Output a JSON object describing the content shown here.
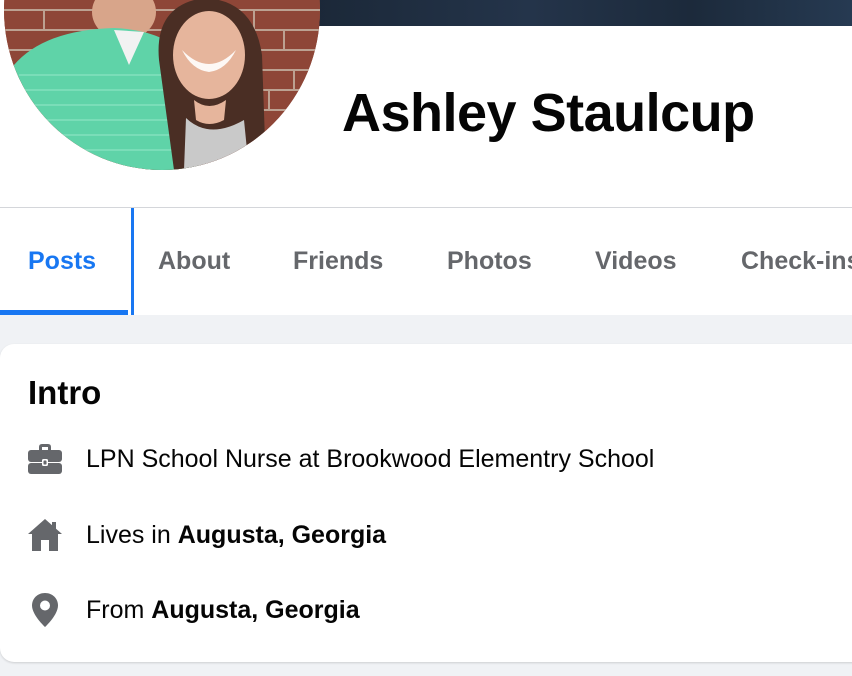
{
  "profile": {
    "name": "Ashley Staulcup"
  },
  "tabs": [
    {
      "label": "Posts",
      "active": true
    },
    {
      "label": "About",
      "active": false
    },
    {
      "label": "Friends",
      "active": false
    },
    {
      "label": "Photos",
      "active": false
    },
    {
      "label": "Videos",
      "active": false
    },
    {
      "label": "Check-ins",
      "active": false
    }
  ],
  "intro": {
    "title": "Intro",
    "work": {
      "icon": "briefcase-icon",
      "text": "LPN School Nurse at Brookwood Elementry School"
    },
    "lives": {
      "icon": "home-icon",
      "prefix": "Lives in ",
      "place": "Augusta, Georgia"
    },
    "from": {
      "icon": "location-pin-icon",
      "prefix": "From ",
      "place": "Augusta, Georgia"
    }
  },
  "colors": {
    "accent": "#1877f2",
    "tab_inactive": "#65676b",
    "page_bg": "#f0f2f5",
    "text": "#050505",
    "icon": "#65676b"
  }
}
